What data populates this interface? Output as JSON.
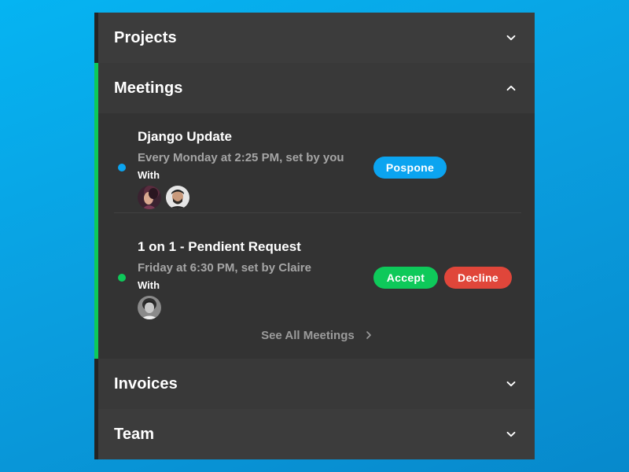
{
  "colors": {
    "background": "#07a6e6",
    "panel": "#333333",
    "header": "#3c3c3c",
    "active_accent": "#0ec95a",
    "blue_status": "#0ba4f0",
    "green_status": "#0ec95a",
    "decline": "#e0463a"
  },
  "sections": [
    {
      "title": "Projects",
      "icon": "chevron-down-icon",
      "expanded": false
    },
    {
      "title": "Meetings",
      "icon": "chevron-up-icon",
      "expanded": true
    },
    {
      "title": "Invoices",
      "icon": "chevron-down-icon",
      "expanded": false
    },
    {
      "title": "Team",
      "icon": "chevron-down-icon",
      "expanded": false
    }
  ],
  "meetings": [
    {
      "title": "Django Update",
      "schedule": "Every Monday at 2:25 PM, set by you",
      "with_label": "With",
      "status_color": "#0ba4f0",
      "attendees": [
        "avatar-woman",
        "avatar-bearded-man"
      ],
      "actions": [
        {
          "label": "Pospone",
          "color": "#0ba4f0"
        }
      ]
    },
    {
      "title": "1 on 1 - Pendient Request",
      "schedule": "Friday at 6:30 PM, set by Claire",
      "with_label": "With",
      "status_color": "#0ec95a",
      "attendees": [
        "avatar-grayscale-person"
      ],
      "actions": [
        {
          "label": "Accept",
          "color": "#0ec95a"
        },
        {
          "label": "Decline",
          "color": "#e0463a"
        }
      ]
    }
  ],
  "see_all": {
    "label": "See All Meetings",
    "icon": "chevron-right-icon"
  }
}
